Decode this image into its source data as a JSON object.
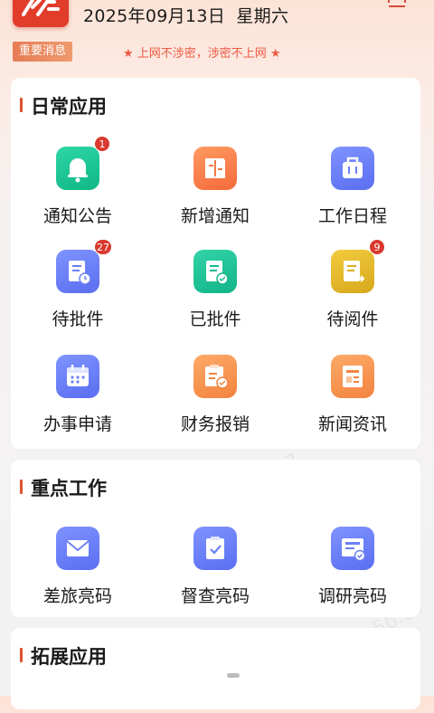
{
  "header": {
    "date_text": "2025年09月13日",
    "weekday_text": "星期六",
    "logo_icon": "brand-logo",
    "scan_icon": "scan-icon"
  },
  "notice": {
    "badge": "重要消息",
    "text": "★ 上网不涉密，涉密不上网 ★"
  },
  "watermark": "2025-09-13 16:56:57",
  "sections": {
    "daily": {
      "title": "日常应用",
      "items": [
        {
          "label": "通知公告",
          "icon": "bell-icon",
          "badge": "1"
        },
        {
          "label": "新增通知",
          "icon": "doc-add-icon"
        },
        {
          "label": "工作日程",
          "icon": "briefcase-icon"
        },
        {
          "label": "待批件",
          "icon": "pending-doc-icon",
          "badge": "27"
        },
        {
          "label": "已批件",
          "icon": "approved-doc-icon"
        },
        {
          "label": "待阅件",
          "icon": "to-read-doc-icon",
          "badge": "9"
        },
        {
          "label": "办事申请",
          "icon": "calendar-icon"
        },
        {
          "label": "财务报销",
          "icon": "clipboard-check-icon"
        },
        {
          "label": "新闻资讯",
          "icon": "news-icon"
        }
      ]
    },
    "key_work": {
      "title": "重点工作",
      "items": [
        {
          "label": "差旅亮码",
          "icon": "envelope-icon"
        },
        {
          "label": "督查亮码",
          "icon": "clipboard-icon"
        },
        {
          "label": "调研亮码",
          "icon": "survey-icon"
        }
      ]
    },
    "extended": {
      "title": "拓展应用"
    }
  },
  "colors": {
    "accent_red": "#e23c2b",
    "notice_red": "#ee5a45",
    "badge_red": "#d9392e"
  }
}
